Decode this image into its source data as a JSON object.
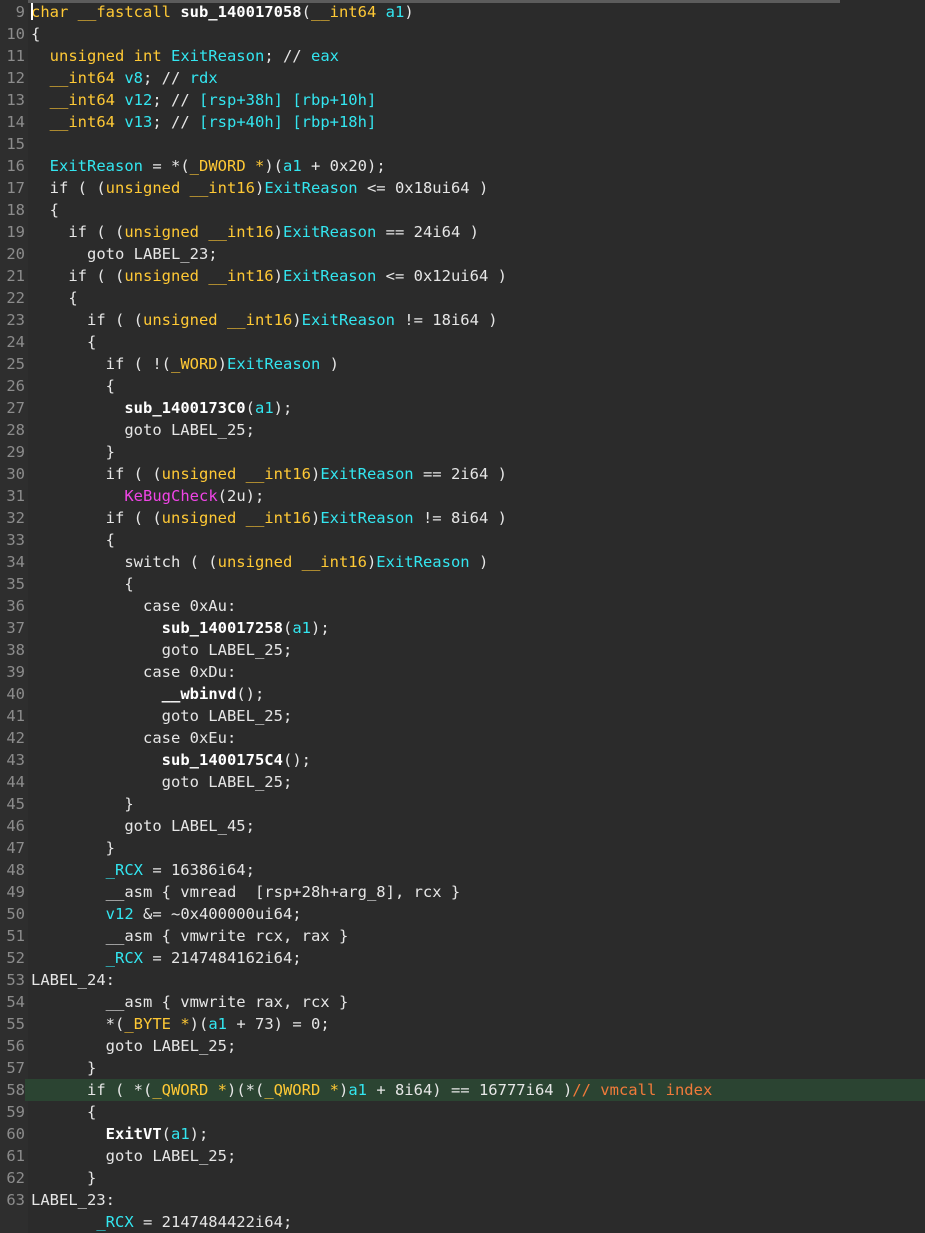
{
  "editor": {
    "theme": {
      "background": "#2b2b2b",
      "text": "#e6e6e6",
      "type": "#ffc935",
      "variable": "#33e6f0",
      "macro": "#f044e6",
      "comment": "#f07a3a",
      "highlight_line": "#2b4432"
    },
    "lines": [
      {
        "n": "9",
        "t": [
          [
            "char __fastcall ",
            "ty"
          ],
          [
            "sub_140017058",
            "fn"
          ],
          [
            "(",
            "kw"
          ],
          [
            "__int64 ",
            "ty"
          ],
          [
            "a1",
            "va"
          ],
          [
            ")",
            "kw"
          ]
        ]
      },
      {
        "n": "10",
        "t": [
          [
            "{",
            "kw"
          ]
        ]
      },
      {
        "n": "11",
        "t": [
          [
            "  unsigned int ",
            "ty"
          ],
          [
            "ExitReason",
            "va"
          ],
          [
            "; // ",
            "kw"
          ],
          [
            "eax",
            "va"
          ]
        ]
      },
      {
        "n": "12",
        "t": [
          [
            "  __int64 ",
            "ty"
          ],
          [
            "v8",
            "va"
          ],
          [
            "; // ",
            "kw"
          ],
          [
            "rdx",
            "va"
          ]
        ]
      },
      {
        "n": "13",
        "t": [
          [
            "  __int64 ",
            "ty"
          ],
          [
            "v12",
            "va"
          ],
          [
            "; // ",
            "kw"
          ],
          [
            "[rsp+38h] [rbp+10h]",
            "va"
          ]
        ]
      },
      {
        "n": "14",
        "t": [
          [
            "  __int64 ",
            "ty"
          ],
          [
            "v13",
            "va"
          ],
          [
            "; // ",
            "kw"
          ],
          [
            "[rsp+40h] [rbp+18h]",
            "va"
          ]
        ]
      },
      {
        "n": "15",
        "t": []
      },
      {
        "n": "16",
        "t": [
          [
            "  ",
            "kw"
          ],
          [
            "ExitReason",
            "va"
          ],
          [
            " = *(",
            "kw"
          ],
          [
            "_DWORD *",
            "ty"
          ],
          [
            ")(",
            "kw"
          ],
          [
            "a1",
            "va"
          ],
          [
            " + 0x20);",
            "kw"
          ]
        ]
      },
      {
        "n": "17",
        "t": [
          [
            "  if ( (",
            "kw"
          ],
          [
            "unsigned __int16",
            "ty"
          ],
          [
            ")",
            "kw"
          ],
          [
            "ExitReason",
            "va"
          ],
          [
            " <= 0x18ui64 )",
            "kw"
          ]
        ]
      },
      {
        "n": "18",
        "t": [
          [
            "  {",
            "kw"
          ]
        ]
      },
      {
        "n": "19",
        "t": [
          [
            "    if ( (",
            "kw"
          ],
          [
            "unsigned __int16",
            "ty"
          ],
          [
            ")",
            "kw"
          ],
          [
            "ExitReason",
            "va"
          ],
          [
            " == 24i64 )",
            "kw"
          ]
        ]
      },
      {
        "n": "20",
        "t": [
          [
            "      goto LABEL_23;",
            "kw"
          ]
        ]
      },
      {
        "n": "21",
        "t": [
          [
            "    if ( (",
            "kw"
          ],
          [
            "unsigned __int16",
            "ty"
          ],
          [
            ")",
            "kw"
          ],
          [
            "ExitReason",
            "va"
          ],
          [
            " <= 0x12ui64 )",
            "kw"
          ]
        ]
      },
      {
        "n": "22",
        "t": [
          [
            "    {",
            "kw"
          ]
        ]
      },
      {
        "n": "23",
        "t": [
          [
            "      if ( (",
            "kw"
          ],
          [
            "unsigned __int16",
            "ty"
          ],
          [
            ")",
            "kw"
          ],
          [
            "ExitReason",
            "va"
          ],
          [
            " != 18i64 )",
            "kw"
          ]
        ]
      },
      {
        "n": "24",
        "t": [
          [
            "      {",
            "kw"
          ]
        ]
      },
      {
        "n": "25",
        "t": [
          [
            "        if ( !(",
            "kw"
          ],
          [
            "_WORD",
            "ty"
          ],
          [
            ")",
            "kw"
          ],
          [
            "ExitReason",
            "va"
          ],
          [
            " )",
            "kw"
          ]
        ]
      },
      {
        "n": "26",
        "t": [
          [
            "        {",
            "kw"
          ]
        ]
      },
      {
        "n": "27",
        "t": [
          [
            "          ",
            "kw"
          ],
          [
            "sub_1400173C0",
            "fn"
          ],
          [
            "(",
            "kw"
          ],
          [
            "a1",
            "va"
          ],
          [
            ");",
            "kw"
          ]
        ]
      },
      {
        "n": "28",
        "t": [
          [
            "          goto LABEL_25;",
            "kw"
          ]
        ]
      },
      {
        "n": "29",
        "t": [
          [
            "        }",
            "kw"
          ]
        ]
      },
      {
        "n": "30",
        "t": [
          [
            "        if ( (",
            "kw"
          ],
          [
            "unsigned __int16",
            "ty"
          ],
          [
            ")",
            "kw"
          ],
          [
            "ExitReason",
            "va"
          ],
          [
            " == 2i64 )",
            "kw"
          ]
        ]
      },
      {
        "n": "31",
        "t": [
          [
            "          ",
            "kw"
          ],
          [
            "KeBugCheck",
            "mg"
          ],
          [
            "(2u);",
            "kw"
          ]
        ]
      },
      {
        "n": "32",
        "t": [
          [
            "        if ( (",
            "kw"
          ],
          [
            "unsigned __int16",
            "ty"
          ],
          [
            ")",
            "kw"
          ],
          [
            "ExitReason",
            "va"
          ],
          [
            " != 8i64 )",
            "kw"
          ]
        ]
      },
      {
        "n": "33",
        "t": [
          [
            "        {",
            "kw"
          ]
        ]
      },
      {
        "n": "34",
        "t": [
          [
            "          switch ( (",
            "kw"
          ],
          [
            "unsigned __int16",
            "ty"
          ],
          [
            ")",
            "kw"
          ],
          [
            "ExitReason",
            "va"
          ],
          [
            " )",
            "kw"
          ]
        ]
      },
      {
        "n": "35",
        "t": [
          [
            "          {",
            "kw"
          ]
        ]
      },
      {
        "n": "36",
        "t": [
          [
            "            case 0xAu:",
            "kw"
          ]
        ]
      },
      {
        "n": "37",
        "t": [
          [
            "              ",
            "kw"
          ],
          [
            "sub_140017258",
            "fn"
          ],
          [
            "(",
            "kw"
          ],
          [
            "a1",
            "va"
          ],
          [
            ");",
            "kw"
          ]
        ]
      },
      {
        "n": "38",
        "t": [
          [
            "              goto LABEL_25;",
            "kw"
          ]
        ]
      },
      {
        "n": "39",
        "t": [
          [
            "            case 0xDu:",
            "kw"
          ]
        ]
      },
      {
        "n": "40",
        "t": [
          [
            "              ",
            "kw"
          ],
          [
            "__wbinvd",
            "fn"
          ],
          [
            "();",
            "kw"
          ]
        ]
      },
      {
        "n": "41",
        "t": [
          [
            "              goto LABEL_25;",
            "kw"
          ]
        ]
      },
      {
        "n": "42",
        "t": [
          [
            "            case 0xEu:",
            "kw"
          ]
        ]
      },
      {
        "n": "43",
        "t": [
          [
            "              ",
            "kw"
          ],
          [
            "sub_1400175C4",
            "fn"
          ],
          [
            "();",
            "kw"
          ]
        ]
      },
      {
        "n": "44",
        "t": [
          [
            "              goto LABEL_25;",
            "kw"
          ]
        ]
      },
      {
        "n": "45",
        "t": [
          [
            "          }",
            "kw"
          ]
        ]
      },
      {
        "n": "46",
        "t": [
          [
            "          goto LABEL_45;",
            "kw"
          ]
        ]
      },
      {
        "n": "47",
        "t": [
          [
            "        }",
            "kw"
          ]
        ]
      },
      {
        "n": "48",
        "t": [
          [
            "        ",
            "kw"
          ],
          [
            "_RCX",
            "va"
          ],
          [
            " = 16386i64;",
            "kw"
          ]
        ]
      },
      {
        "n": "49",
        "t": [
          [
            "        __asm { vmread  [rsp+28h+arg_8], rcx }",
            "kw"
          ]
        ]
      },
      {
        "n": "50",
        "t": [
          [
            "        ",
            "kw"
          ],
          [
            "v12",
            "va"
          ],
          [
            " &= ~0x400000ui64;",
            "kw"
          ]
        ]
      },
      {
        "n": "51",
        "t": [
          [
            "        __asm { vmwrite rcx, rax }",
            "kw"
          ]
        ]
      },
      {
        "n": "52",
        "t": [
          [
            "        ",
            "kw"
          ],
          [
            "_RCX",
            "va"
          ],
          [
            " = 2147484162i64;",
            "kw"
          ]
        ]
      },
      {
        "n": "53",
        "t": [
          [
            "LABEL_24:",
            "lb"
          ]
        ]
      },
      {
        "n": "54",
        "t": [
          [
            "        __asm { vmwrite rax, rcx }",
            "kw"
          ]
        ]
      },
      {
        "n": "55",
        "t": [
          [
            "        *(",
            "kw"
          ],
          [
            "_BYTE *",
            "ty"
          ],
          [
            ")(",
            "kw"
          ],
          [
            "a1",
            "va"
          ],
          [
            " + 73) = 0;",
            "kw"
          ]
        ]
      },
      {
        "n": "56",
        "t": [
          [
            "        goto LABEL_25;",
            "kw"
          ]
        ]
      },
      {
        "n": "57",
        "t": [
          [
            "      }",
            "kw"
          ]
        ]
      },
      {
        "n": "58",
        "hl": true,
        "t": [
          [
            "      if ( *(",
            "kw"
          ],
          [
            "_QWORD *",
            "ty"
          ],
          [
            ")(*(",
            "kw"
          ],
          [
            "_QWORD *",
            "ty"
          ],
          [
            ")",
            "kw"
          ],
          [
            "a1",
            "va"
          ],
          [
            " + 8i64) == 16777i64 )",
            "kw"
          ],
          [
            "// vmcall index",
            "cm"
          ]
        ]
      },
      {
        "n": "59",
        "t": [
          [
            "      {",
            "kw"
          ]
        ]
      },
      {
        "n": "60",
        "t": [
          [
            "        ",
            "kw"
          ],
          [
            "ExitVT",
            "fn"
          ],
          [
            "(",
            "kw"
          ],
          [
            "a1",
            "va"
          ],
          [
            ");",
            "kw"
          ]
        ]
      },
      {
        "n": "61",
        "t": [
          [
            "        goto LABEL_25;",
            "kw"
          ]
        ]
      },
      {
        "n": "62",
        "t": [
          [
            "      }",
            "kw"
          ]
        ]
      },
      {
        "n": "63",
        "t": [
          [
            "LABEL_23:",
            "lb"
          ]
        ]
      },
      {
        "n": "",
        "t": [
          [
            "       ",
            "kw"
          ],
          [
            "_RCX",
            "va"
          ],
          [
            " = 2147484422i64;",
            "kw"
          ]
        ]
      }
    ]
  }
}
